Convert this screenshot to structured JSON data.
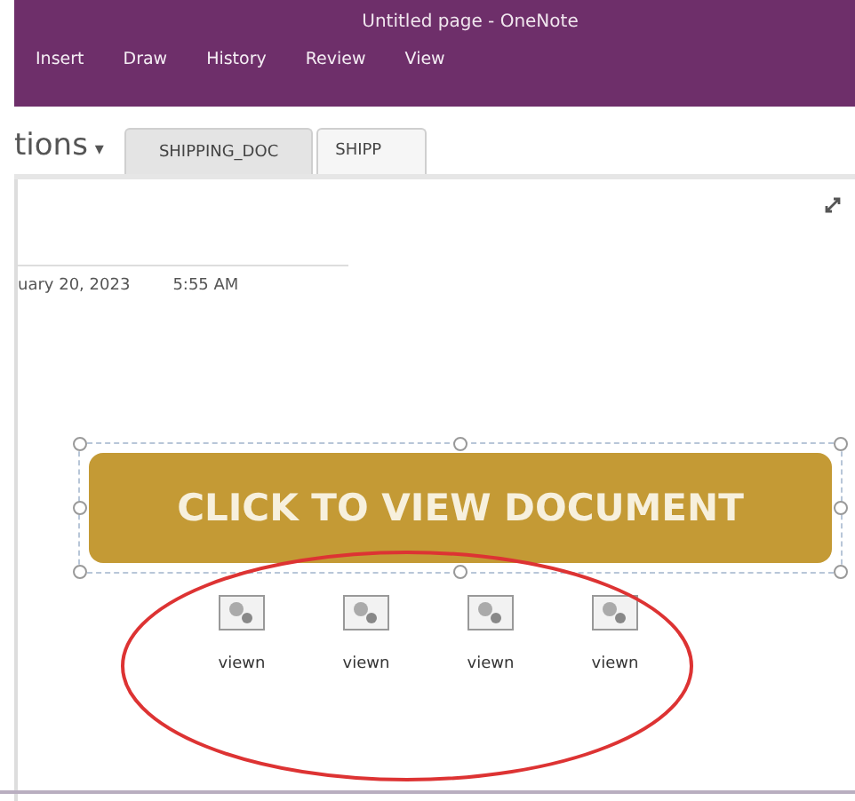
{
  "window": {
    "title": "Untitled page - OneNote"
  },
  "ribbon_tabs": [
    {
      "label": "Insert"
    },
    {
      "label": "Draw"
    },
    {
      "label": "History"
    },
    {
      "label": "Review"
    },
    {
      "label": "View"
    }
  ],
  "notebook": {
    "sections_label": "tions",
    "caret": "▾"
  },
  "section_tabs": [
    {
      "label": "SHIPPING_DOC",
      "selected": false
    },
    {
      "label": "SHIPP",
      "selected": true
    }
  ],
  "page": {
    "date": "uary 20, 2023",
    "time": "5:55 AM"
  },
  "banner": {
    "label": "CLICK TO VIEW DOCUMENT",
    "selected": true
  },
  "attachments": [
    {
      "label": "viewn"
    },
    {
      "label": "viewn"
    },
    {
      "label": "viewn"
    },
    {
      "label": "viewn"
    }
  ]
}
